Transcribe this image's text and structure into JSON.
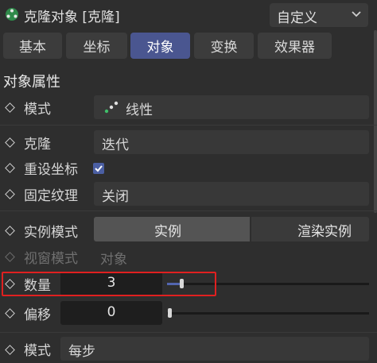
{
  "header": {
    "title": "克隆对象 [克隆]",
    "preset": "自定义",
    "icon": "cloner-object-icon"
  },
  "tabs": [
    {
      "label": "基本",
      "active": false
    },
    {
      "label": "坐标",
      "active": false
    },
    {
      "label": "对象",
      "active": true
    },
    {
      "label": "变换",
      "active": false
    },
    {
      "label": "效果器",
      "active": false
    }
  ],
  "section_title": "对象属性",
  "rows": {
    "mode": {
      "label": "模式",
      "value": "线性",
      "icon": "linear-mode-icon"
    },
    "clones": {
      "label": "克隆",
      "value": "迭代"
    },
    "reset_coords": {
      "label": "重设坐标",
      "checked": true
    },
    "fix_texture": {
      "label": "固定纹理",
      "value": "关闭"
    },
    "instance_mode": {
      "label": "实例模式",
      "options": [
        "实例",
        "渲染实例"
      ],
      "selected": "实例"
    },
    "viewport_mode": {
      "label": "视窗模式",
      "value": "对象",
      "disabled": true
    },
    "count": {
      "label": "数量",
      "value": "3",
      "slider_fraction": 0.06
    },
    "offset": {
      "label": "偏移",
      "value": "0",
      "slider_fraction": 0.0
    },
    "mode2": {
      "label": "模式",
      "value": "每步"
    }
  },
  "colors": {
    "accent": "#4a5690",
    "highlight": "#e02020"
  }
}
